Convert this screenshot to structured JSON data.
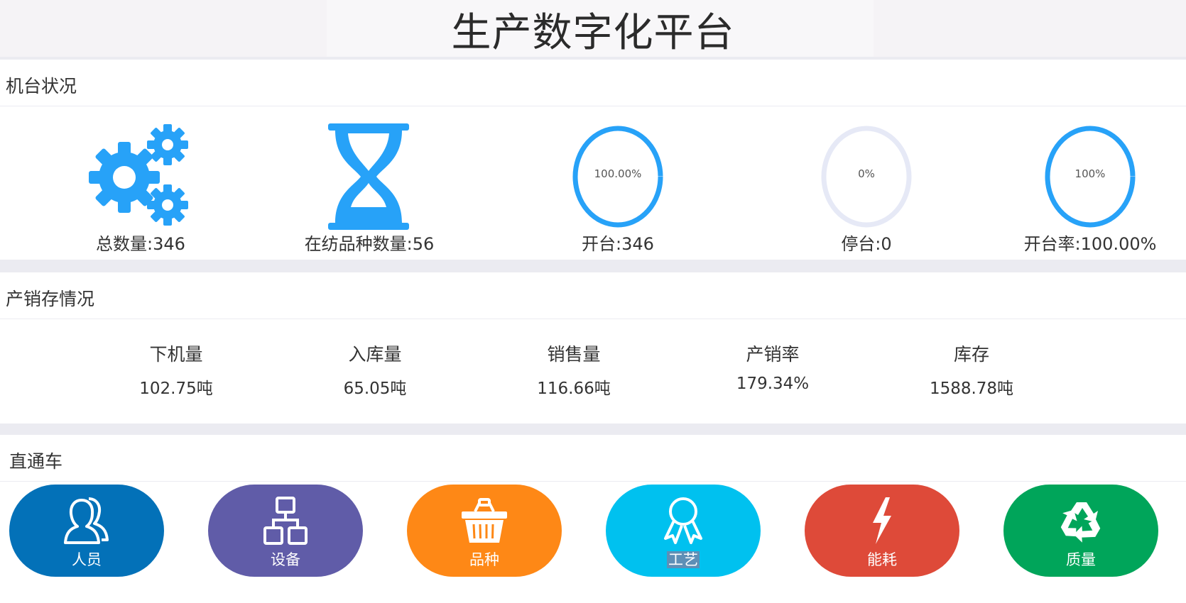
{
  "header": {
    "title": "生产数字化平台"
  },
  "machine_status": {
    "title": "机台状况",
    "items": [
      {
        "label": "总数量:346",
        "icon": "gears-icon"
      },
      {
        "label": "在纺品种数量:56",
        "icon": "hourglass-icon"
      },
      {
        "label": "开台:346",
        "ring_text": "100.00%",
        "ring_percent": 100
      },
      {
        "label": "停台:0",
        "ring_text": "0%",
        "ring_percent": 0
      },
      {
        "label": "开台率:100.00%",
        "ring_text": "100%",
        "ring_percent": 100
      }
    ],
    "colors": {
      "accent": "#27a2f8",
      "ring_track": "#e6e9f6"
    }
  },
  "sales": {
    "title": "产销存情况",
    "stats": [
      {
        "label": "下机量",
        "value": "102.75吨"
      },
      {
        "label": "入库量",
        "value": "65.05吨"
      },
      {
        "label": "销售量",
        "value": "116.66吨"
      },
      {
        "label": "产销率",
        "value": "179.34%"
      },
      {
        "label": "库存",
        "value": "1588.78吨"
      }
    ]
  },
  "express": {
    "title": "直通车",
    "buttons": [
      {
        "label": "人员",
        "icon": "person-icon",
        "color": "#0371b8"
      },
      {
        "label": "设备",
        "icon": "network-icon",
        "color": "#605ca8"
      },
      {
        "label": "品种",
        "icon": "basket-icon",
        "color": "#fe8816"
      },
      {
        "label": "工艺",
        "icon": "award-icon",
        "color": "#00c1ef"
      },
      {
        "label": "能耗",
        "icon": "lightning-icon",
        "color": "#de4a39"
      },
      {
        "label": "质量",
        "icon": "recycle-icon",
        "color": "#00a55a"
      }
    ]
  }
}
